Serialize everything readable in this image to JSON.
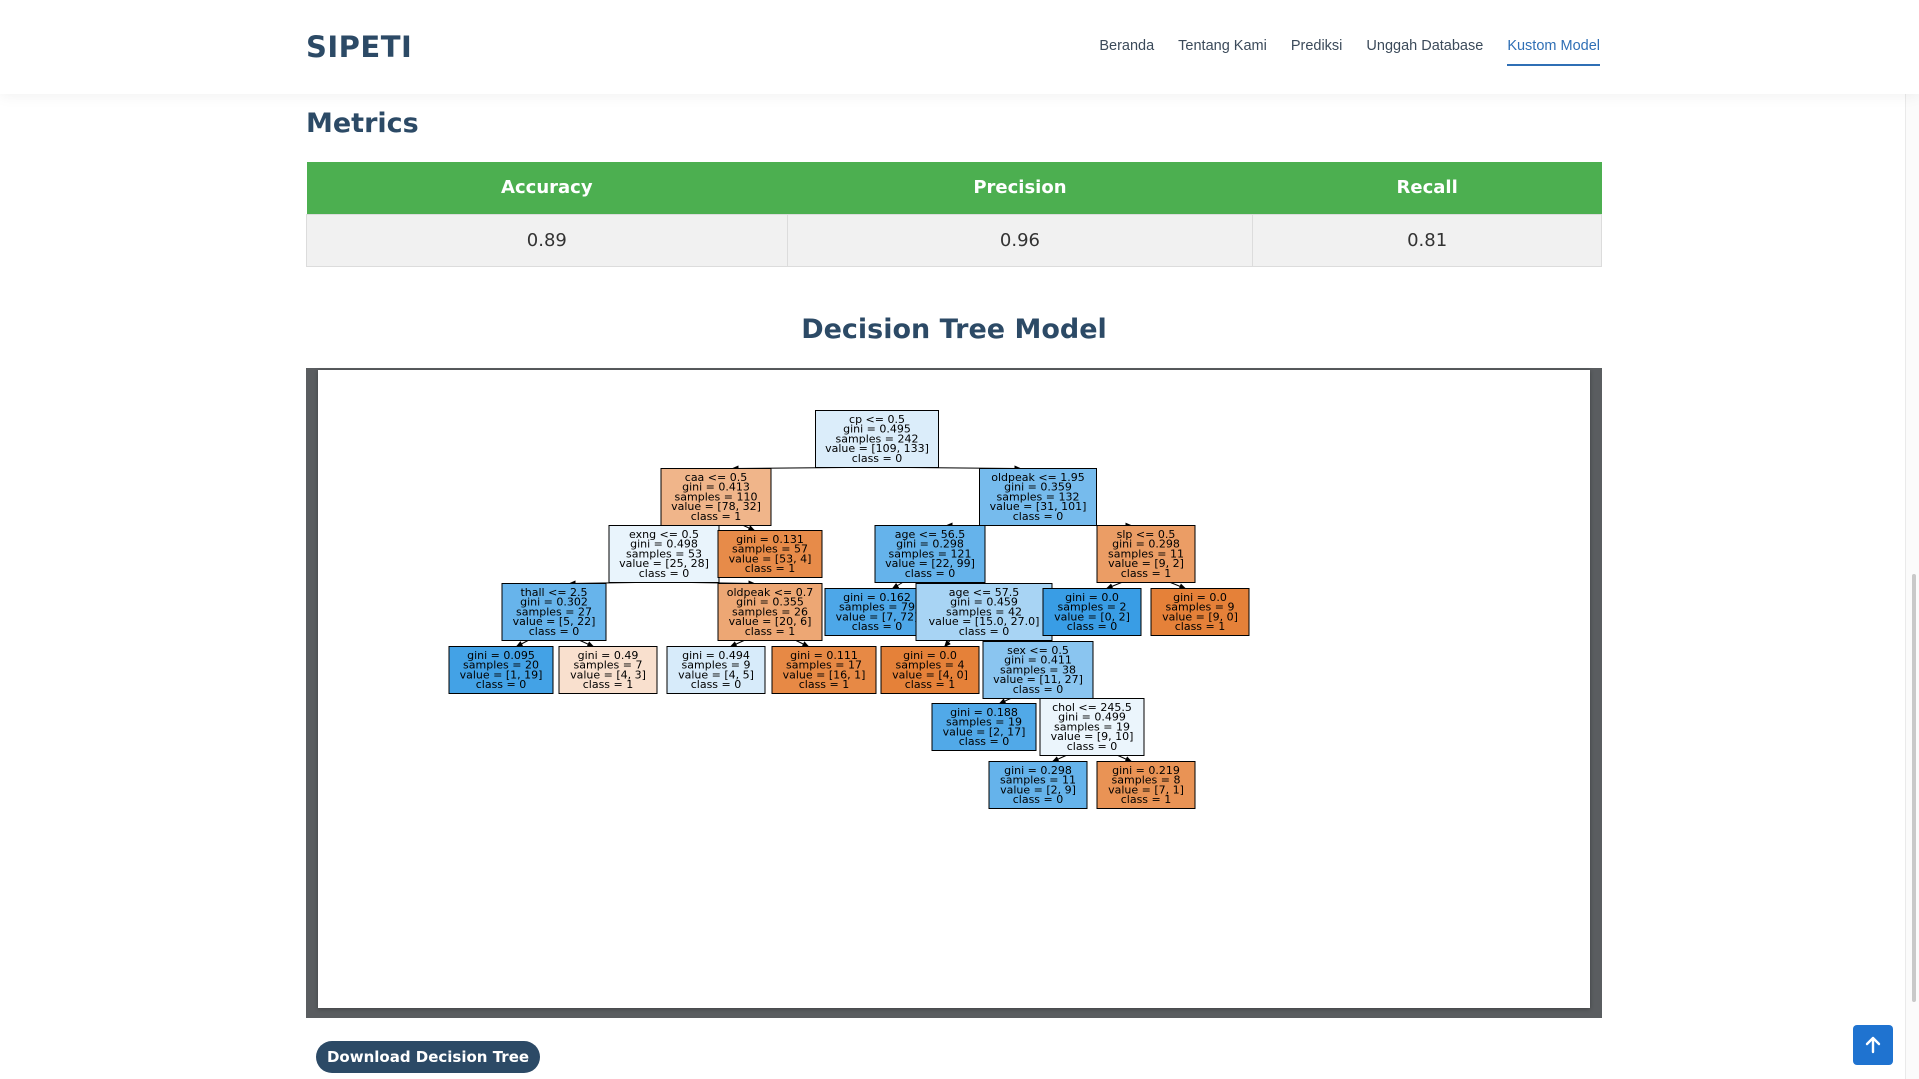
{
  "header": {
    "logo": "SIPETI",
    "nav": [
      {
        "label": "Beranda",
        "active": false
      },
      {
        "label": "Tentang Kami",
        "active": false
      },
      {
        "label": "Prediksi",
        "active": false
      },
      {
        "label": "Unggah Database",
        "active": false
      },
      {
        "label": "Kustom Model",
        "active": true
      }
    ]
  },
  "metrics": {
    "title": "Metrics",
    "headers": [
      "Accuracy",
      "Precision",
      "Recall"
    ],
    "values": [
      "0.89",
      "0.96",
      "0.81"
    ],
    "header_color": "#4caf50"
  },
  "tree": {
    "title": "Decision Tree Model",
    "colors": {
      "class_0": "#399de5",
      "class_1": "#e58139"
    },
    "nodes": [
      {
        "id": "n0",
        "parent": null,
        "depth": 0,
        "lines": [
          "cp <= 0.5",
          "gini = 0.495",
          "samples = 242",
          "value = [109, 133]",
          "class = 0"
        ],
        "class": 0,
        "purity": 0.18
      },
      {
        "id": "n1",
        "parent": "n0",
        "depth": 1,
        "lines": [
          "caa <= 0.5",
          "gini = 0.413",
          "samples = 110",
          "value = [78, 32]",
          "class = 1"
        ],
        "class": 1,
        "purity": 0.59
      },
      {
        "id": "n2",
        "parent": "n0",
        "depth": 1,
        "lines": [
          "oldpeak <= 1.95",
          "gini = 0.359",
          "samples = 132",
          "value = [31, 101]",
          "class = 0"
        ],
        "class": 0,
        "purity": 0.69
      },
      {
        "id": "n3",
        "parent": "n1",
        "depth": 2,
        "lines": [
          "exng <= 0.5",
          "gini = 0.498",
          "samples = 53",
          "value = [25, 28]",
          "class = 0"
        ],
        "class": 0,
        "purity": 0.11
      },
      {
        "id": "n4",
        "parent": "n1",
        "depth": 2,
        "lines": [
          "gini = 0.131",
          "samples = 57",
          "value = [53, 4]",
          "class = 1"
        ],
        "class": 1,
        "purity": 0.92
      },
      {
        "id": "n5",
        "parent": "n2",
        "depth": 2,
        "lines": [
          "age <= 56.5",
          "gini = 0.298",
          "samples = 121",
          "value = [22, 99]",
          "class = 0"
        ],
        "class": 0,
        "purity": 0.78
      },
      {
        "id": "n6",
        "parent": "n2",
        "depth": 2,
        "lines": [
          "slp <= 0.5",
          "gini = 0.298",
          "samples = 11",
          "value = [9, 2]",
          "class = 1"
        ],
        "class": 1,
        "purity": 0.78
      },
      {
        "id": "n7",
        "parent": "n3",
        "depth": 3,
        "lines": [
          "thall <= 2.5",
          "gini = 0.302",
          "samples = 27",
          "value = [5, 22]",
          "class = 0"
        ],
        "class": 0,
        "purity": 0.77
      },
      {
        "id": "n8",
        "parent": "n3",
        "depth": 3,
        "lines": [
          "oldpeak <= 0.7",
          "gini = 0.355",
          "samples = 26",
          "value = [20, 6]",
          "class = 1"
        ],
        "class": 1,
        "purity": 0.7
      },
      {
        "id": "n9",
        "parent": "n5",
        "depth": 3,
        "lines": [
          "gini = 0.162",
          "samples = 79",
          "value = [7, 72]",
          "class = 0"
        ],
        "class": 0,
        "purity": 0.9
      },
      {
        "id": "n10",
        "parent": "n5",
        "depth": 3,
        "lines": [
          "age <= 57.5",
          "gini = 0.459",
          "samples = 42",
          "value = [15.0, 27.0]",
          "class = 0"
        ],
        "class": 0,
        "purity": 0.44
      },
      {
        "id": "n11",
        "parent": "n6",
        "depth": 3,
        "lines": [
          "gini = 0.0",
          "samples = 2",
          "value = [0, 2]",
          "class = 0"
        ],
        "class": 0,
        "purity": 1.0
      },
      {
        "id": "n12",
        "parent": "n6",
        "depth": 3,
        "lines": [
          "gini = 0.0",
          "samples = 9",
          "value = [9, 0]",
          "class = 1"
        ],
        "class": 1,
        "purity": 1.0
      },
      {
        "id": "n13",
        "parent": "n7",
        "depth": 4,
        "lines": [
          "gini = 0.095",
          "samples = 20",
          "value = [1, 19]",
          "class = 0"
        ],
        "class": 0,
        "purity": 0.95
      },
      {
        "id": "n14",
        "parent": "n7",
        "depth": 4,
        "lines": [
          "gini = 0.49",
          "samples = 7",
          "value = [4, 3]",
          "class = 1"
        ],
        "class": 1,
        "purity": 0.25
      },
      {
        "id": "n15",
        "parent": "n8",
        "depth": 4,
        "lines": [
          "gini = 0.494",
          "samples = 9",
          "value = [4, 5]",
          "class = 0"
        ],
        "class": 0,
        "purity": 0.2
      },
      {
        "id": "n16",
        "parent": "n8",
        "depth": 4,
        "lines": [
          "gini = 0.111",
          "samples = 17",
          "value = [16, 1]",
          "class = 1"
        ],
        "class": 1,
        "purity": 0.94
      },
      {
        "id": "n17",
        "parent": "n10",
        "depth": 4,
        "lines": [
          "gini = 0.0",
          "samples = 4",
          "value = [4, 0]",
          "class = 1"
        ],
        "class": 1,
        "purity": 1.0
      },
      {
        "id": "n18",
        "parent": "n10",
        "depth": 4,
        "lines": [
          "sex <= 0.5",
          "gini = 0.411",
          "samples = 38",
          "value = [11, 27]",
          "class = 0"
        ],
        "class": 0,
        "purity": 0.59
      },
      {
        "id": "n19",
        "parent": "n18",
        "depth": 5,
        "lines": [
          "gini = 0.188",
          "samples = 19",
          "value = [2, 17]",
          "class = 0"
        ],
        "class": 0,
        "purity": 0.88
      },
      {
        "id": "n20",
        "parent": "n18",
        "depth": 5,
        "lines": [
          "chol <= 245.5",
          "gini = 0.499",
          "samples = 19",
          "value = [9, 10]",
          "class = 0"
        ],
        "class": 0,
        "purity": 0.1
      },
      {
        "id": "n21",
        "parent": "n20",
        "depth": 6,
        "lines": [
          "gini = 0.298",
          "samples = 11",
          "value = [2, 9]",
          "class = 0"
        ],
        "class": 0,
        "purity": 0.78
      },
      {
        "id": "n22",
        "parent": "n20",
        "depth": 6,
        "lines": [
          "gini = 0.219",
          "samples = 8",
          "value = [7, 1]",
          "class = 1"
        ],
        "class": 1,
        "purity": 0.86
      }
    ]
  },
  "buttons": {
    "download_label": "Download Decision Tree",
    "back_to_top_icon": "arrow-up-icon"
  }
}
